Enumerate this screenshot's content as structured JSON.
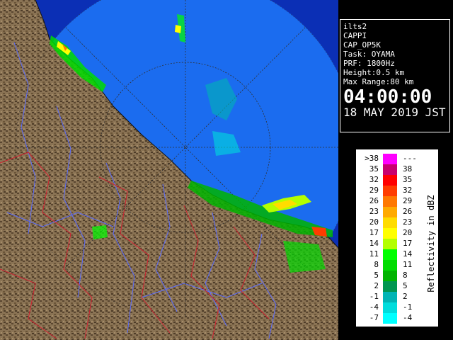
{
  "info": {
    "lines": [
      "ilts2",
      "CAPPI",
      "CAP_OP5K",
      "Task: OYAMA",
      "PRF: 1800Hz",
      "Height:0.5 km",
      "Max Range:80 km"
    ],
    "time": "04:00:00",
    "date": "18 MAY 2019 JST"
  },
  "legend": {
    "title": "Reflectivity in dBZ",
    "rows": [
      {
        "lo": ">38",
        "hi": "---",
        "color": "#ff00ff"
      },
      {
        "lo": "35",
        "hi": "38",
        "color": "#c8006e"
      },
      {
        "lo": "32",
        "hi": "35",
        "color": "#ff0000"
      },
      {
        "lo": "29",
        "hi": "32",
        "color": "#ff3c00"
      },
      {
        "lo": "26",
        "hi": "29",
        "color": "#ff7800"
      },
      {
        "lo": "23",
        "hi": "26",
        "color": "#ffaa00"
      },
      {
        "lo": "20",
        "hi": "23",
        "color": "#ffdc00"
      },
      {
        "lo": "17",
        "hi": "20",
        "color": "#ffff00"
      },
      {
        "lo": "14",
        "hi": "17",
        "color": "#b4ff00"
      },
      {
        "lo": "11",
        "hi": "14",
        "color": "#00ff00"
      },
      {
        "lo": "8",
        "hi": "11",
        "color": "#00dc00"
      },
      {
        "lo": "5",
        "hi": "8",
        "color": "#00b400"
      },
      {
        "lo": "2",
        "hi": "5",
        "color": "#009650"
      },
      {
        "lo": "-1",
        "hi": "2",
        "color": "#00b4b4"
      },
      {
        "lo": "-4",
        "hi": "-1",
        "color": "#00dcdc"
      },
      {
        "lo": "-7",
        "hi": "-4",
        "color": "#00ffff"
      }
    ]
  },
  "map": {
    "colors": {
      "sea": "#0b2fb5",
      "coverage": "#1b6cef",
      "land": "#8a7354",
      "land_dark": "#5a4630",
      "rivers": "#5a6cff",
      "borders": "#d02030",
      "rings": "#333333"
    }
  }
}
